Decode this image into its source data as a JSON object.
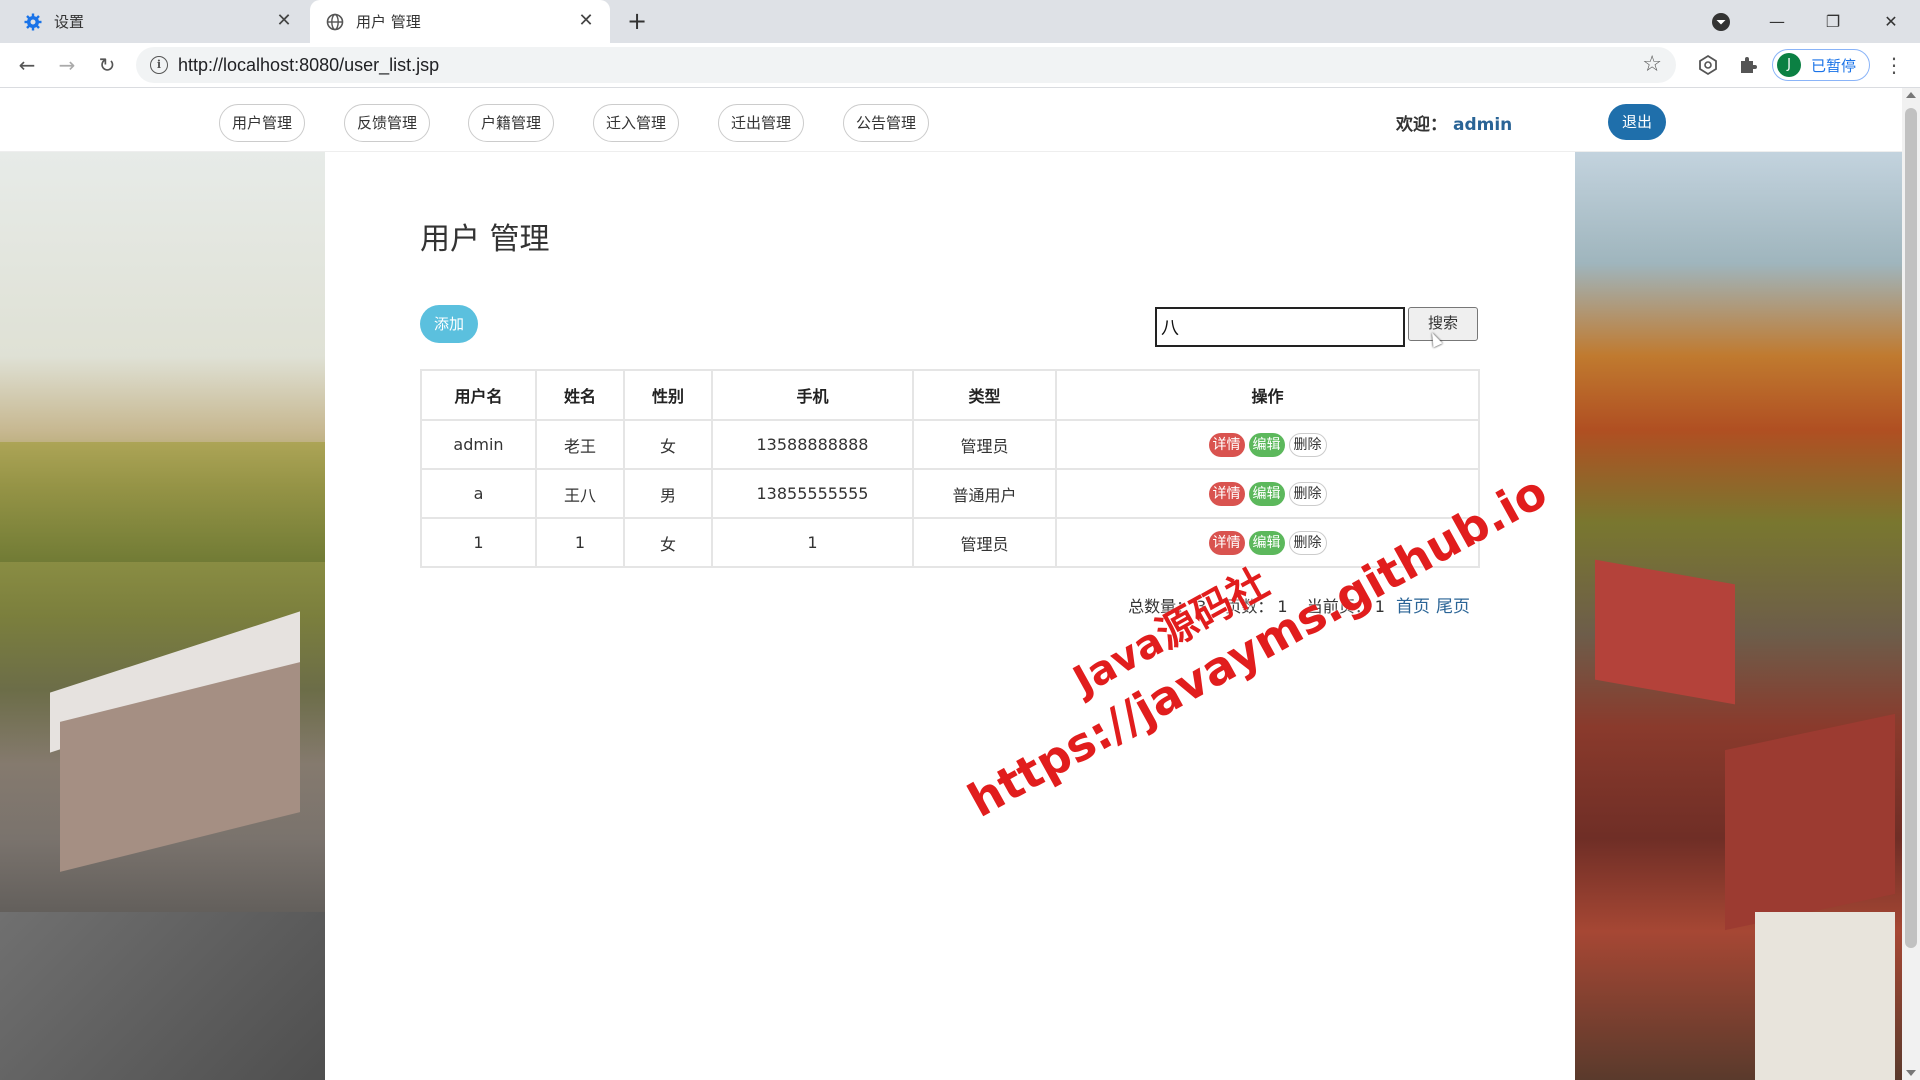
{
  "browser": {
    "tabs": [
      {
        "title": "设置",
        "icon": "gear-icon"
      },
      {
        "title": "用户 管理",
        "icon": "globe-icon"
      }
    ],
    "url": "http://localhost:8080/user_list.jsp",
    "profile_initial": "J",
    "profile_status": "已暂停"
  },
  "nav": {
    "items": [
      "用户管理",
      "反馈管理",
      "户籍管理",
      "迁入管理",
      "迁出管理",
      "公告管理"
    ],
    "welcome_label": "欢迎：",
    "username": "admin",
    "logout_label": "退出"
  },
  "main": {
    "title": "用户 管理",
    "add_label": "添加",
    "search_value": "八",
    "search_label": "搜索",
    "table": {
      "headers": [
        "用户名",
        "姓名",
        "性别",
        "手机",
        "类型",
        "操作"
      ],
      "rows": [
        {
          "username": "admin",
          "name": "老王",
          "gender": "女",
          "phone": "13588888888",
          "type": "管理员"
        },
        {
          "username": "a",
          "name": "王八",
          "gender": "男",
          "phone": "13855555555",
          "type": "普通用户"
        },
        {
          "username": "1",
          "name": "1",
          "gender": "女",
          "phone": "1",
          "type": "管理员"
        }
      ],
      "actions": {
        "detail": "详情",
        "edit": "编辑",
        "delete": "删除"
      }
    },
    "pager": {
      "total_label": "总数量：",
      "total": "3",
      "pages_label": "页数：",
      "pages": "1",
      "current_label": "当前页：",
      "current": "1",
      "first": "首页",
      "last": "尾页"
    }
  },
  "watermark": {
    "line1": "Java源码社",
    "line2": "https://javayms.github.io"
  },
  "colors": {
    "add_button": "#5bc0de",
    "logout_button": "#1f6fab",
    "detail_badge": "#d9534f",
    "edit_badge": "#5cb85c",
    "link": "#2a6496",
    "watermark": "#e11d1d"
  }
}
